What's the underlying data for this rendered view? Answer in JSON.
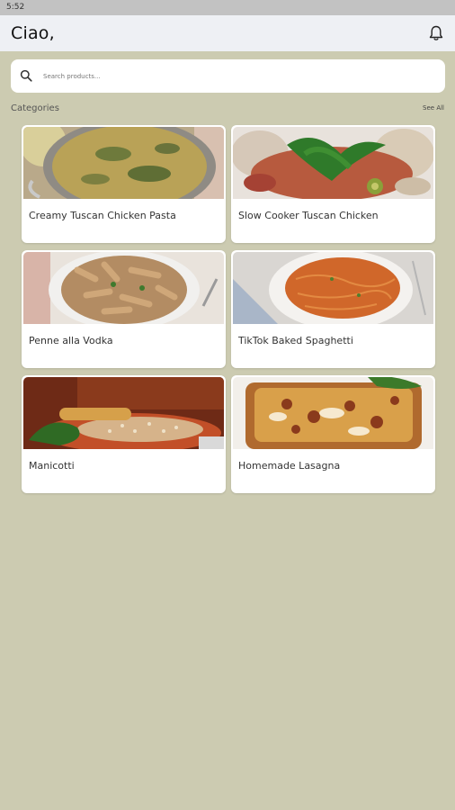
{
  "status_bar": {
    "time": "5:52"
  },
  "header": {
    "greeting": "Ciao,"
  },
  "search": {
    "placeholder": "Search products..."
  },
  "section": {
    "title": "Categories",
    "see_all": "See All"
  },
  "recipes": [
    {
      "name": "Creamy Tuscan Chicken Pasta"
    },
    {
      "name": "Slow Cooker Tuscan Chicken"
    },
    {
      "name": "Penne alla Vodka"
    },
    {
      "name": "TikTok Baked Spaghetti"
    },
    {
      "name": "Manicotti"
    },
    {
      "name": "Homemade Lasagna"
    }
  ],
  "colors": {
    "background": "#cccbb1",
    "app_bar": "#eef0f4",
    "status_bar": "#c2c2c2",
    "card": "#ffffff"
  },
  "icons": {
    "notification": "bell-icon",
    "search": "search-icon"
  }
}
